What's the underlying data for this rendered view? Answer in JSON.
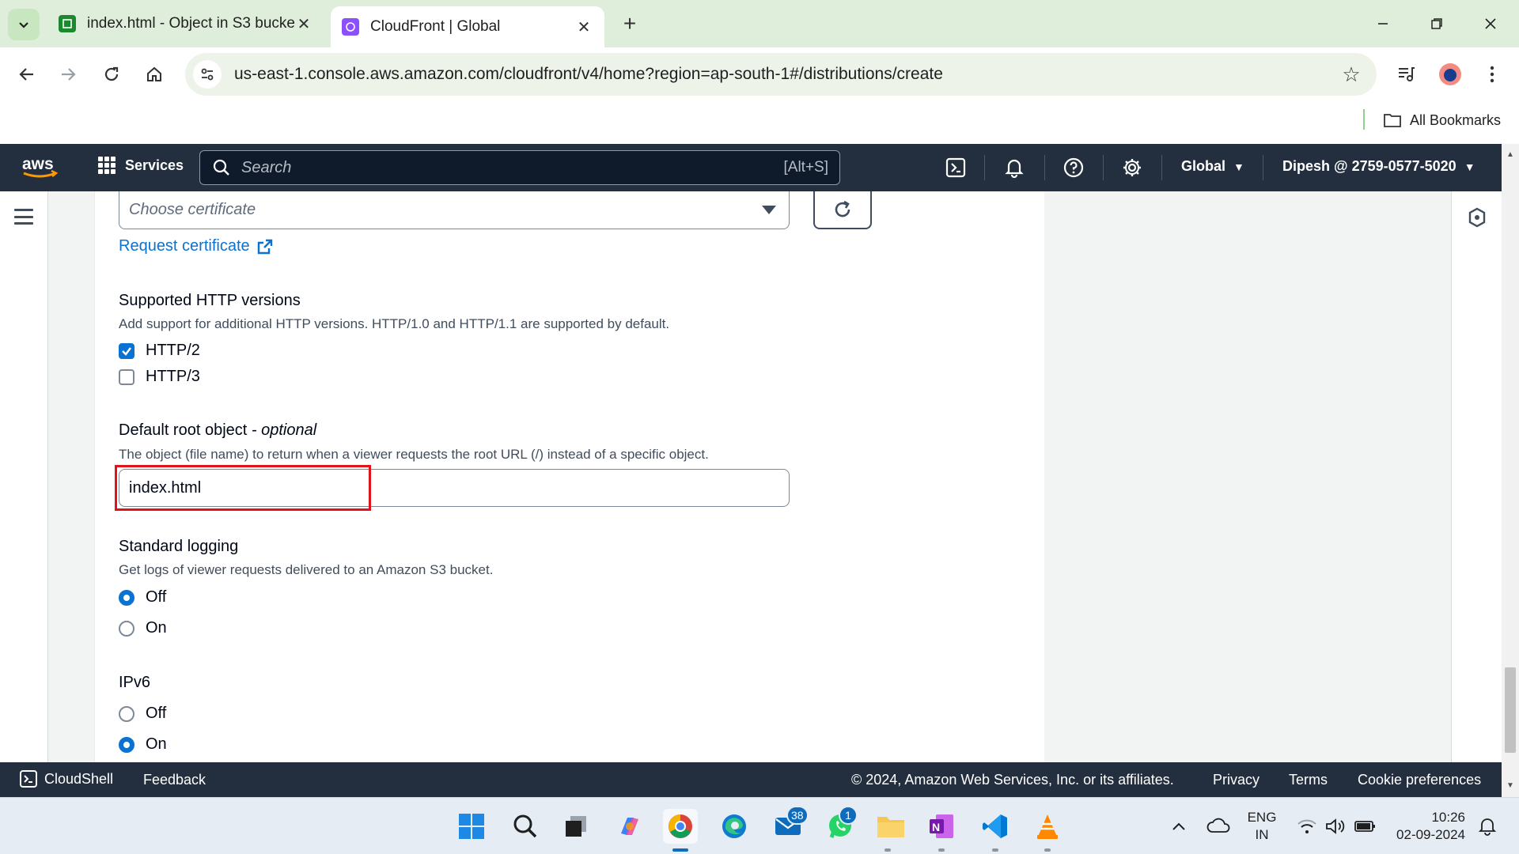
{
  "browser": {
    "tabs": [
      {
        "title": "index.html - Object in S3 bucke",
        "active": false
      },
      {
        "title": "CloudFront | Global",
        "active": true
      }
    ],
    "url": "us-east-1.console.aws.amazon.com/cloudfront/v4/home?region=ap-south-1#/distributions/create",
    "bookmarks_label": "All Bookmarks"
  },
  "aws_nav": {
    "services_label": "Services",
    "search_placeholder": "Search",
    "search_shortcut": "[Alt+S]",
    "region": "Global",
    "account": "Dipesh @ 2759-0577-5020"
  },
  "form": {
    "certificate_placeholder": "Choose certificate",
    "request_certificate_link": "Request certificate",
    "http_versions": {
      "label": "Supported HTTP versions",
      "description": "Add support for additional HTTP versions. HTTP/1.0 and HTTP/1.1 are supported by default.",
      "options": [
        {
          "label": "HTTP/2",
          "checked": true
        },
        {
          "label": "HTTP/3",
          "checked": false
        }
      ]
    },
    "default_root": {
      "label": "Default root object",
      "label_suffix": "- optional",
      "description": "The object (file name) to return when a viewer requests the root URL (/) instead of a specific object.",
      "value": "index.html"
    },
    "standard_logging": {
      "label": "Standard logging",
      "description": "Get logs of viewer requests delivered to an Amazon S3 bucket.",
      "options": [
        {
          "label": "Off",
          "selected": true
        },
        {
          "label": "On",
          "selected": false
        }
      ]
    },
    "ipv6": {
      "label": "IPv6",
      "options": [
        {
          "label": "Off",
          "selected": false
        },
        {
          "label": "On",
          "selected": true
        }
      ]
    }
  },
  "aws_footer": {
    "cloudshell": "CloudShell",
    "feedback": "Feedback",
    "copyright": "© 2024, Amazon Web Services, Inc. or its affiliates.",
    "privacy": "Privacy",
    "terms": "Terms",
    "cookies": "Cookie preferences"
  },
  "taskbar": {
    "mail_badge": "38",
    "whatsapp_badge": "1",
    "language": "ENG",
    "region": "IN",
    "time": "10:26",
    "date": "02-09-2024"
  },
  "colors": {
    "aws_nav": "#232f3e",
    "link": "#0972d3",
    "highlight": "#e0131a",
    "chrome_tabstrip": "#dfeedb"
  }
}
